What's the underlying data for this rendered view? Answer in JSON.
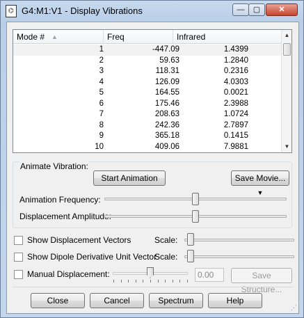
{
  "window": {
    "title": "G4:M1:V1 - Display Vibrations",
    "minimize_glyph": "—",
    "maximize_glyph": "▢",
    "close_glyph": "✕",
    "icon": "molecule-document-icon"
  },
  "table": {
    "headers": [
      "Mode #",
      "Freq",
      "Infrared"
    ],
    "rows": [
      {
        "mode": "1",
        "freq": "-447.09",
        "ir": "1.4399"
      },
      {
        "mode": "2",
        "freq": "59.63",
        "ir": "1.2840"
      },
      {
        "mode": "3",
        "freq": "118.31",
        "ir": "0.2316"
      },
      {
        "mode": "4",
        "freq": "126.09",
        "ir": "4.0303"
      },
      {
        "mode": "5",
        "freq": "164.55",
        "ir": "0.0021"
      },
      {
        "mode": "6",
        "freq": "175.46",
        "ir": "2.3988"
      },
      {
        "mode": "7",
        "freq": "208.63",
        "ir": "1.0724"
      },
      {
        "mode": "8",
        "freq": "242.36",
        "ir": "2.7897"
      },
      {
        "mode": "9",
        "freq": "365.18",
        "ir": "0.1415"
      },
      {
        "mode": "10",
        "freq": "409.06",
        "ir": "7.9881"
      }
    ],
    "selected_row": 0
  },
  "animate": {
    "group_label": "Animate Vibration:",
    "start_button": "Start Animation",
    "save_movie_button": "Save Movie...",
    "frequency_label": "Animation Frequency:",
    "frequency_level": 0.5,
    "amplitude_label": "Displacement Amplitude:",
    "amplitude_level": 0.5
  },
  "options": {
    "show_displacement_vectors": "Show Displacement Vectors",
    "show_dipole_vector": "Show Dipole Derivative Unit Vector",
    "scale_label": "Scale:",
    "manual_displacement": "Manual Displacement:",
    "manual_value": "0.00",
    "save_structure_button": "Save Structure..."
  },
  "footer": {
    "close": "Close",
    "cancel": "Cancel",
    "spectrum": "Spectrum",
    "help": "Help"
  },
  "colors": {
    "title_bar": "#c6d9ee",
    "dialog_bg": "#f0f0f0",
    "close_button": "#c6452f"
  }
}
